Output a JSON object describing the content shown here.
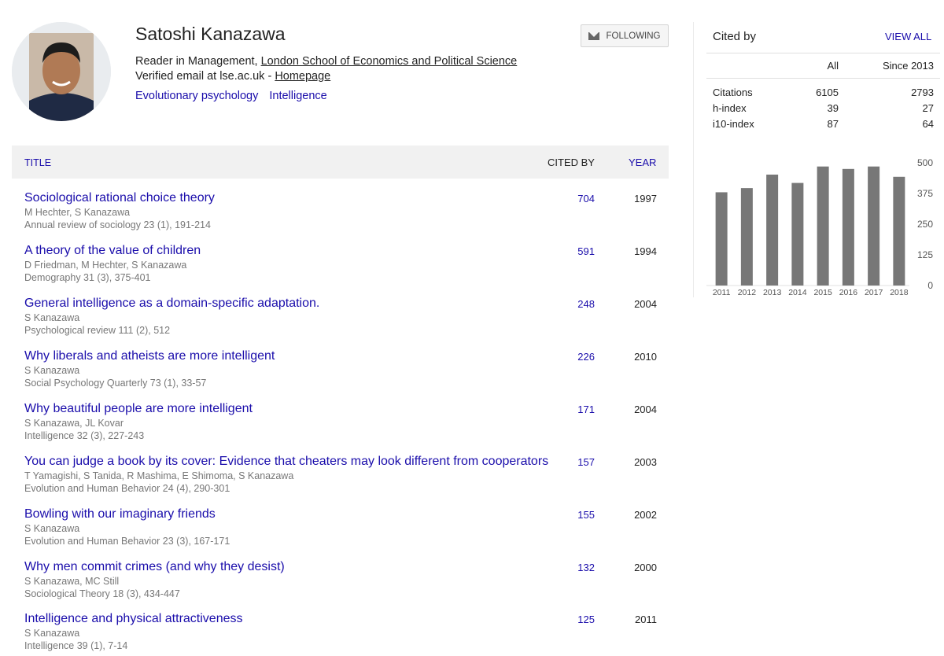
{
  "profile": {
    "name": "Satoshi Kanazawa",
    "position_prefix": "Reader in Management, ",
    "affiliation_link": "London School of Economics and Political Science",
    "email_text": "Verified email at lse.ac.uk - ",
    "homepage_link": "Homepage",
    "interests": [
      "Evolutionary psychology",
      "Intelligence"
    ],
    "follow_label": "FOLLOWING",
    "follow_icon": "mail-icon"
  },
  "table": {
    "title_header": "TITLE",
    "cited_header": "CITED BY",
    "year_header": "YEAR",
    "articles": [
      {
        "title": "Sociological rational choice theory",
        "authors": "M Hechter, S Kanazawa",
        "venue": "Annual review of sociology 23 (1), 191-214",
        "cited": "704",
        "year": "1997"
      },
      {
        "title": "A theory of the value of children",
        "authors": "D Friedman, M Hechter, S Kanazawa",
        "venue": "Demography 31 (3), 375-401",
        "cited": "591",
        "year": "1994"
      },
      {
        "title": "General intelligence as a domain-specific adaptation.",
        "authors": "S Kanazawa",
        "venue": "Psychological review 111 (2), 512",
        "cited": "248",
        "year": "2004"
      },
      {
        "title": "Why liberals and atheists are more intelligent",
        "authors": "S Kanazawa",
        "venue": "Social Psychology Quarterly 73 (1), 33-57",
        "cited": "226",
        "year": "2010"
      },
      {
        "title": "Why beautiful people are more intelligent",
        "authors": "S Kanazawa, JL Kovar",
        "venue": "Intelligence 32 (3), 227-243",
        "cited": "171",
        "year": "2004"
      },
      {
        "title": "You can judge a book by its cover: Evidence that cheaters may look different from cooperators",
        "authors": "T Yamagishi, S Tanida, R Mashima, E Shimoma, S Kanazawa",
        "venue": "Evolution and Human Behavior 24 (4), 290-301",
        "cited": "157",
        "year": "2003"
      },
      {
        "title": "Bowling with our imaginary friends",
        "authors": "S Kanazawa",
        "venue": "Evolution and Human Behavior 23 (3), 167-171",
        "cited": "155",
        "year": "2002"
      },
      {
        "title": "Why men commit crimes (and why they desist)",
        "authors": "S Kanazawa, MC Still",
        "venue": "Sociological Theory 18 (3), 434-447",
        "cited": "132",
        "year": "2000"
      },
      {
        "title": "Intelligence and physical attractiveness",
        "authors": "S Kanazawa",
        "venue": "Intelligence 39 (1), 7-14",
        "cited": "125",
        "year": "2011"
      }
    ]
  },
  "cited_by": {
    "title": "Cited by",
    "view_all": "VIEW ALL",
    "col_all": "All",
    "col_since": "Since 2013",
    "rows": [
      {
        "label": "Citations",
        "all": "6105",
        "since": "2793"
      },
      {
        "label": "h-index",
        "all": "39",
        "since": "27"
      },
      {
        "label": "i10-index",
        "all": "87",
        "since": "64"
      }
    ]
  },
  "chart_data": {
    "type": "bar",
    "categories": [
      "2011",
      "2012",
      "2013",
      "2014",
      "2015",
      "2016",
      "2017",
      "2018"
    ],
    "values": [
      380,
      397,
      452,
      418,
      485,
      475,
      485,
      443
    ],
    "yticks": [
      0,
      125,
      250,
      375,
      500
    ],
    "ylim": [
      0,
      500
    ],
    "bar_color": "#777777",
    "grid": false
  },
  "colors": {
    "link": "#1a0dab",
    "header_bg": "#f1f1f1",
    "muted": "#777777"
  }
}
